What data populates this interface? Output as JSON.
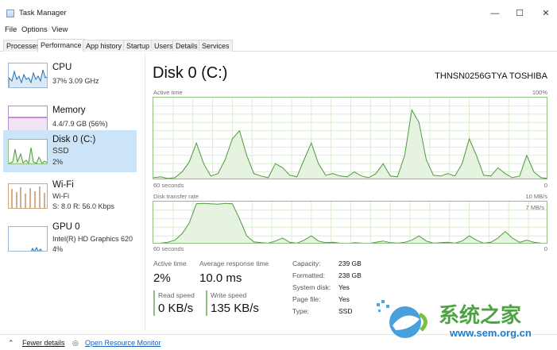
{
  "window": {
    "title": "Task Manager",
    "minimize_glyph": "—",
    "maximize_glyph": "☐",
    "close_glyph": "✕"
  },
  "menu": [
    "File",
    "Options",
    "View"
  ],
  "tabs": [
    {
      "label": "Processes",
      "active": false
    },
    {
      "label": "Performance",
      "active": true
    },
    {
      "label": "App history",
      "active": false
    },
    {
      "label": "Startup",
      "active": false
    },
    {
      "label": "Users",
      "active": false
    },
    {
      "label": "Details",
      "active": false
    },
    {
      "label": "Services",
      "active": false
    }
  ],
  "sidebar": {
    "items": [
      {
        "name": "CPU",
        "line1": "37%  3.09 GHz",
        "line2": "",
        "selected": false,
        "color": "#1f6fb5"
      },
      {
        "name": "Memory",
        "line1": "4.4/7.9 GB (56%)",
        "line2": "",
        "selected": false,
        "color": "#8b2fa8"
      },
      {
        "name": "Disk 0 (C:)",
        "line1": "SSD",
        "line2": "2%",
        "selected": true,
        "color": "#4e9a3b"
      },
      {
        "name": "Wi-Fi",
        "line1": "Wi-Fi",
        "line2": "S: 8.0  R: 56.0 Kbps",
        "selected": false,
        "color": "#a65f1c"
      },
      {
        "name": "GPU 0",
        "line1": "Intel(R) HD Graphics 620",
        "line2": "4%",
        "selected": false,
        "color": "#1f6fb5"
      }
    ]
  },
  "disk": {
    "title": "Disk 0 (C:)",
    "model": "THNSN0256GTYA TOSHIBA",
    "graph1": {
      "top_left": "Active time",
      "top_right": "100%",
      "bottom_left": "60 seconds",
      "bottom_right": "0",
      "levels": [
        0.03,
        0.04,
        0.02,
        0.03,
        0.1,
        0.22,
        0.45,
        0.2,
        0.05,
        0.08,
        0.25,
        0.5,
        0.6,
        0.3,
        0.08,
        0.05,
        0.03,
        0.2,
        0.15,
        0.06,
        0.04,
        0.25,
        0.45,
        0.2,
        0.06,
        0.08,
        0.05,
        0.04,
        0.1,
        0.05,
        0.03,
        0.08,
        0.2,
        0.05,
        0.04,
        0.3,
        0.85,
        0.7,
        0.25,
        0.06,
        0.05,
        0.08,
        0.05,
        0.2,
        0.5,
        0.3,
        0.06,
        0.05,
        0.15,
        0.08,
        0.03,
        0.05,
        0.3,
        0.1,
        0.03,
        0.02
      ]
    },
    "graph2": {
      "top_left": "Disk transfer rate",
      "top_right": "10 MB/s",
      "scale_mark": "7 MB/s",
      "bottom_left": "60 seconds",
      "bottom_right": "0",
      "levels": [
        0.02,
        0.03,
        0.05,
        0.1,
        0.25,
        0.5,
        0.95,
        0.96,
        0.95,
        0.94,
        0.96,
        0.95,
        0.6,
        0.2,
        0.06,
        0.04,
        0.03,
        0.08,
        0.15,
        0.05,
        0.03,
        0.1,
        0.2,
        0.08,
        0.04,
        0.05,
        0.03,
        0.02,
        0.04,
        0.03,
        0.02,
        0.05,
        0.08,
        0.04,
        0.03,
        0.05,
        0.1,
        0.2,
        0.08,
        0.03,
        0.04,
        0.05,
        0.03,
        0.08,
        0.2,
        0.1,
        0.03,
        0.05,
        0.15,
        0.3,
        0.15,
        0.05,
        0.1,
        0.05,
        0.03,
        0.02
      ]
    },
    "stats": {
      "active_time_label": "Active time",
      "active_time_value": "2%",
      "response_label": "Average response time",
      "response_value": "10.0 ms",
      "read_label": "Read speed",
      "read_value": "0 KB/s",
      "write_label": "Write speed",
      "write_value": "135 KB/s"
    },
    "info": [
      {
        "label": "Capacity:",
        "value": "239 GB"
      },
      {
        "label": "Formatted:",
        "value": "238 GB"
      },
      {
        "label": "System disk:",
        "value": "Yes"
      },
      {
        "label": "Page file:",
        "value": "Yes"
      },
      {
        "label": "Type:",
        "value": "SSD"
      }
    ]
  },
  "footer": {
    "fewer_details": "Fewer details",
    "open_monitor": "Open Resource Monitor"
  },
  "watermark": {
    "brand": "系统之家",
    "url": "www.sem.org.cn"
  },
  "colors": {
    "accent_disk": "#4e9a3b",
    "graph_fill": "#e6f3e0",
    "link": "#1a5fb4",
    "selection": "#cce4f7"
  }
}
